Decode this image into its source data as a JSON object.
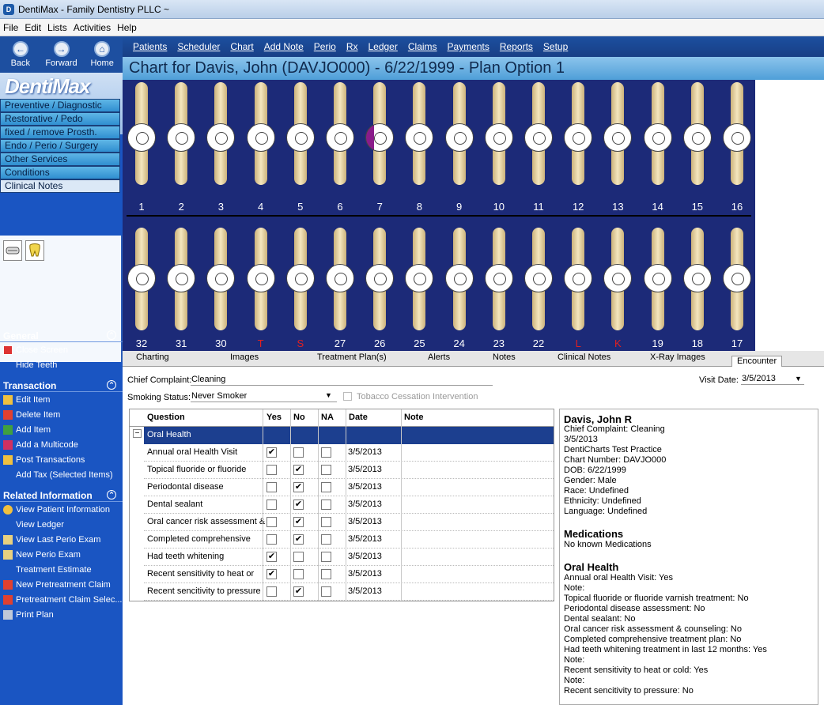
{
  "app": {
    "title": "DentiMax - Family Dentistry PLLC ~",
    "icon": "D"
  },
  "menu": [
    "File",
    "Edit",
    "Lists",
    "Activities",
    "Help"
  ],
  "nav": {
    "back": "Back",
    "forward": "Forward",
    "home": "Home"
  },
  "logo": "DentiMax",
  "categories": [
    "Preventive / Diagnostic",
    "Restorative / Pedo",
    "fixed / remove  Prosth.",
    "Endo / Perio / Surgery",
    "Other Services",
    "Conditions",
    "Clinical Notes"
  ],
  "left_sections": {
    "general": {
      "title": "General",
      "items": [
        "Close Screen",
        "Hide Teeth"
      ]
    },
    "transaction": {
      "title": "Transaction",
      "items": [
        "Edit Item",
        "Delete Item",
        "Add Item",
        "Add a Multicode",
        "Post Transactions",
        "Add Tax (Selected Items)"
      ]
    },
    "related": {
      "title": "Related Information",
      "items": [
        "View Patient Information",
        "View Ledger",
        "View Last Perio Exam",
        "New Perio Exam",
        "Treatment Estimate",
        "New Pretreatment Claim",
        "Pretreatment Claim Selec...",
        "Print Plan"
      ]
    }
  },
  "chart_menu": [
    "Patients",
    "Scheduler",
    "Chart",
    "Add Note",
    "Perio",
    "Rx",
    "Ledger",
    "Claims",
    "Payments",
    "Reports",
    "Setup"
  ],
  "chart_title": "Chart for Davis, John (DAVJO000) - 6/22/1999 - Plan Option 1",
  "upper_teeth": [
    "1",
    "2",
    "3",
    "4",
    "5",
    "6",
    "7",
    "8",
    "9",
    "10",
    "11",
    "12",
    "13",
    "14",
    "15",
    "16"
  ],
  "lower_teeth": [
    "32",
    "31",
    "30",
    "T",
    "S",
    "27",
    "26",
    "25",
    "24",
    "23",
    "22",
    "L",
    "K",
    "19",
    "18",
    "17"
  ],
  "lower_red": [
    3,
    4,
    11,
    12
  ],
  "highlight_color": "#8a1c8a",
  "tabs": [
    "Charting",
    "Images",
    "Treatment Plan(s)",
    "Alerts",
    "Notes",
    "Clinical Notes",
    "X-Ray Images",
    "Encounter"
  ],
  "form": {
    "chief_label": "Chief Complaint:",
    "chief_value": "Cleaning",
    "smoking_label": "Smoking Status:",
    "smoking_value": "Never Smoker",
    "tobacco_label": "Tobacco Cessation Intervention",
    "visit_label": "Visit Date:",
    "visit_value": "3/5/2013"
  },
  "grid": {
    "headers": {
      "question": "Question",
      "yes": "Yes",
      "no": "No",
      "na": "NA",
      "date": "Date",
      "note": "Note"
    },
    "group": "Oral Health",
    "rows": [
      {
        "q": "Annual oral Health Visit",
        "yes": "✔",
        "no": "",
        "na": "",
        "date": "3/5/2013"
      },
      {
        "q": "Topical fluoride or fluoride",
        "yes": "",
        "no": "✔",
        "na": "",
        "date": "3/5/2013"
      },
      {
        "q": "Periodontal disease",
        "yes": "",
        "no": "✔",
        "na": "",
        "date": "3/5/2013"
      },
      {
        "q": "Dental sealant",
        "yes": "",
        "no": "✔",
        "na": "",
        "date": "3/5/2013"
      },
      {
        "q": "Oral cancer risk assessment &",
        "yes": "",
        "no": "✔",
        "na": "",
        "date": "3/5/2013"
      },
      {
        "q": "Completed comprehensive",
        "yes": "",
        "no": "✔",
        "na": "",
        "date": "3/5/2013"
      },
      {
        "q": "Had teeth whitening",
        "yes": "✔",
        "no": "",
        "na": "",
        "date": "3/5/2013"
      },
      {
        "q": "Recent sensitivity to heat or",
        "yes": "✔",
        "no": "",
        "na": "",
        "date": "3/5/2013"
      },
      {
        "q": "Recent sencitivity to pressure",
        "yes": "",
        "no": "✔",
        "na": "",
        "date": "3/5/2013"
      }
    ]
  },
  "summary": {
    "name": "Davis, John R",
    "lines": [
      "Chief Complaint: Cleaning",
      "3/5/2013",
      "DentiCharts Test Practice",
      "Chart Number: DAVJO000",
      "DOB: 6/22/1999",
      "Gender: Male",
      "Race: Undefined",
      "Ethnicity: Undefined",
      "Language: Undefined"
    ],
    "med_title": "Medications",
    "med_text": "No known Medications",
    "oral_title": "Oral Health",
    "oral_lines": [
      "Annual oral Health Visit: Yes",
      "Note:",
      "Topical fluoride or fluoride varnish treatment: No",
      "Periodontal disease assessment: No",
      "Dental sealant: No",
      "Oral cancer risk assessment & counseling: No",
      "Completed comprehensive treatment plan: No",
      "Had teeth whitening treatment in last 12 months: Yes",
      "Note:",
      "Recent sensitivity to heat or cold: Yes",
      "Note:",
      "Recent sencitivity to pressure: No"
    ]
  }
}
